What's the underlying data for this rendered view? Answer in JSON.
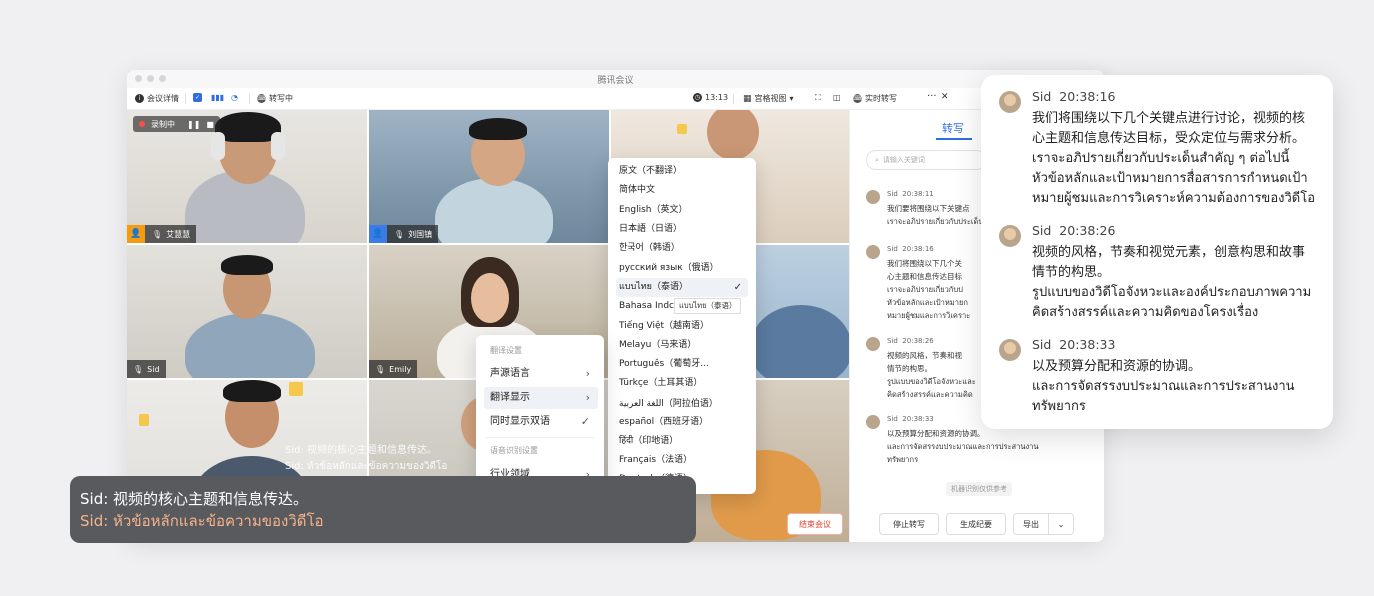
{
  "window": {
    "title": "腾讯会议",
    "toolbar": {
      "meeting_info": "会议详情",
      "transcribing": "转写中",
      "timer": "13:13",
      "grid_view": "宫格视图",
      "realtime_transcribe": "实时转写",
      "more": "···",
      "close": "✕"
    }
  },
  "video": {
    "recording_label": "录制中",
    "participants": [
      {
        "name": "艾慧慧"
      },
      {
        "name": "刘国镇"
      },
      {
        "name": "Sid"
      },
      {
        "name": "Emily"
      }
    ]
  },
  "transcript_panel": {
    "tab": "转写",
    "search_placeholder": "请输入关键词",
    "entries": [
      {
        "speaker": "Sid",
        "time": "20:38:11",
        "lines": [
          "我们要将围绕以下关键点",
          "เราจะอภิปรายเกี่ยวกับประเด็น"
        ]
      },
      {
        "speaker": "Sid",
        "time": "20:38:16",
        "lines": [
          "我们将围绕以下几个关",
          "心主题和信息传达目标",
          "เราจะอภิปรายเกี่ยวกับป",
          "หัวข้อหลักและเป้าหมายก",
          "หมายผู้ชมและการวิเคราะ"
        ]
      },
      {
        "speaker": "Sid",
        "time": "20:38:26",
        "lines": [
          "视频的风格，节奏和视",
          "情节的构思。",
          "รูปแบบของวิดีโอจังหวะและ",
          "คิดสร้างสรรค์และความคิด"
        ]
      },
      {
        "speaker": "Sid",
        "time": "20:38:33",
        "lines": [
          "以及预算分配和资源的协调。",
          "และการจัดสรรงบประมาณและการประสานงาน",
          "ทรัพยากร"
        ]
      }
    ],
    "machine_note": "机器识别仅供参考",
    "buttons": {
      "end_meeting": "结束会议",
      "stop_transcribe": "停止转写",
      "generate_minutes": "生成纪要",
      "export": "导出"
    }
  },
  "language_menu": {
    "items": [
      "原文（不翻译）",
      "简体中文",
      "English（英文）",
      "日本語（日语）",
      "한국어（韩语）",
      "русский язык（俄语）",
      "แบบไทย（泰语）",
      "Bahasa Indc",
      "Tiếng Việt（越南语）",
      "Melayu（马来语）",
      "Português（葡萄牙...",
      "Türkçe（土耳其语）",
      "اللغة العربية（阿拉伯语）",
      "español（西班牙语）",
      "हिंदी（印地语）",
      "Français（法语）",
      "Deutsch（德语）"
    ],
    "selected_index": 6,
    "truncated_tooltip": "แบบไทย（泰语）"
  },
  "settings_menu": {
    "translate_header": "翻译设置",
    "source_language": "声源语言",
    "translate_display": "翻译显示",
    "bilingual": "同时显示双语",
    "recognition_header": "语音识别设置",
    "industry": "行业领域"
  },
  "subtitle": {
    "speaker": "Sid",
    "zh": "视频的核心主题和信息传达。",
    "th": "หัวข้อหลักและข้อความของวิดีโอ"
  },
  "faint_subtitle": {
    "zh": "Sid: 视频的核心主题和信息传达。",
    "th": "Sid: หัวข้อหลักและข้อความของวิดีโอ"
  },
  "zoom_card": {
    "entries": [
      {
        "speaker": "Sid",
        "time": "20:38:16",
        "lines": [
          "我们将围绕以下几个关键点进行讨论，视频的核",
          "心主题和信息传达目标，受众定位与需求分析。",
          "เราจะอภิปรายเกี่ยวกับประเด็นสำคัญ ๆ ต่อไปนี้",
          "หัวข้อหลักและเป้าหมายการสื่อสารการกำหนดเป้า",
          "หมายผู้ชมและการวิเคราะห์ความต้องการของวิดีโอ"
        ]
      },
      {
        "speaker": "Sid",
        "time": "20:38:26",
        "lines": [
          "视频的风格，节奏和视觉元素，创意构思和故事",
          "情节的构思。",
          "รูปแบบของวิดีโอจังหวะและองค์ประกอบภาพความ",
          "คิดสร้างสรรค์และความคิดของโครงเรื่อง"
        ]
      },
      {
        "speaker": "Sid",
        "time": "20:38:33",
        "lines": [
          "以及预算分配和资源的协调。",
          "และการจัดสรรงบประมาณและการประสานงาน",
          "ทรัพยากร"
        ]
      }
    ]
  }
}
